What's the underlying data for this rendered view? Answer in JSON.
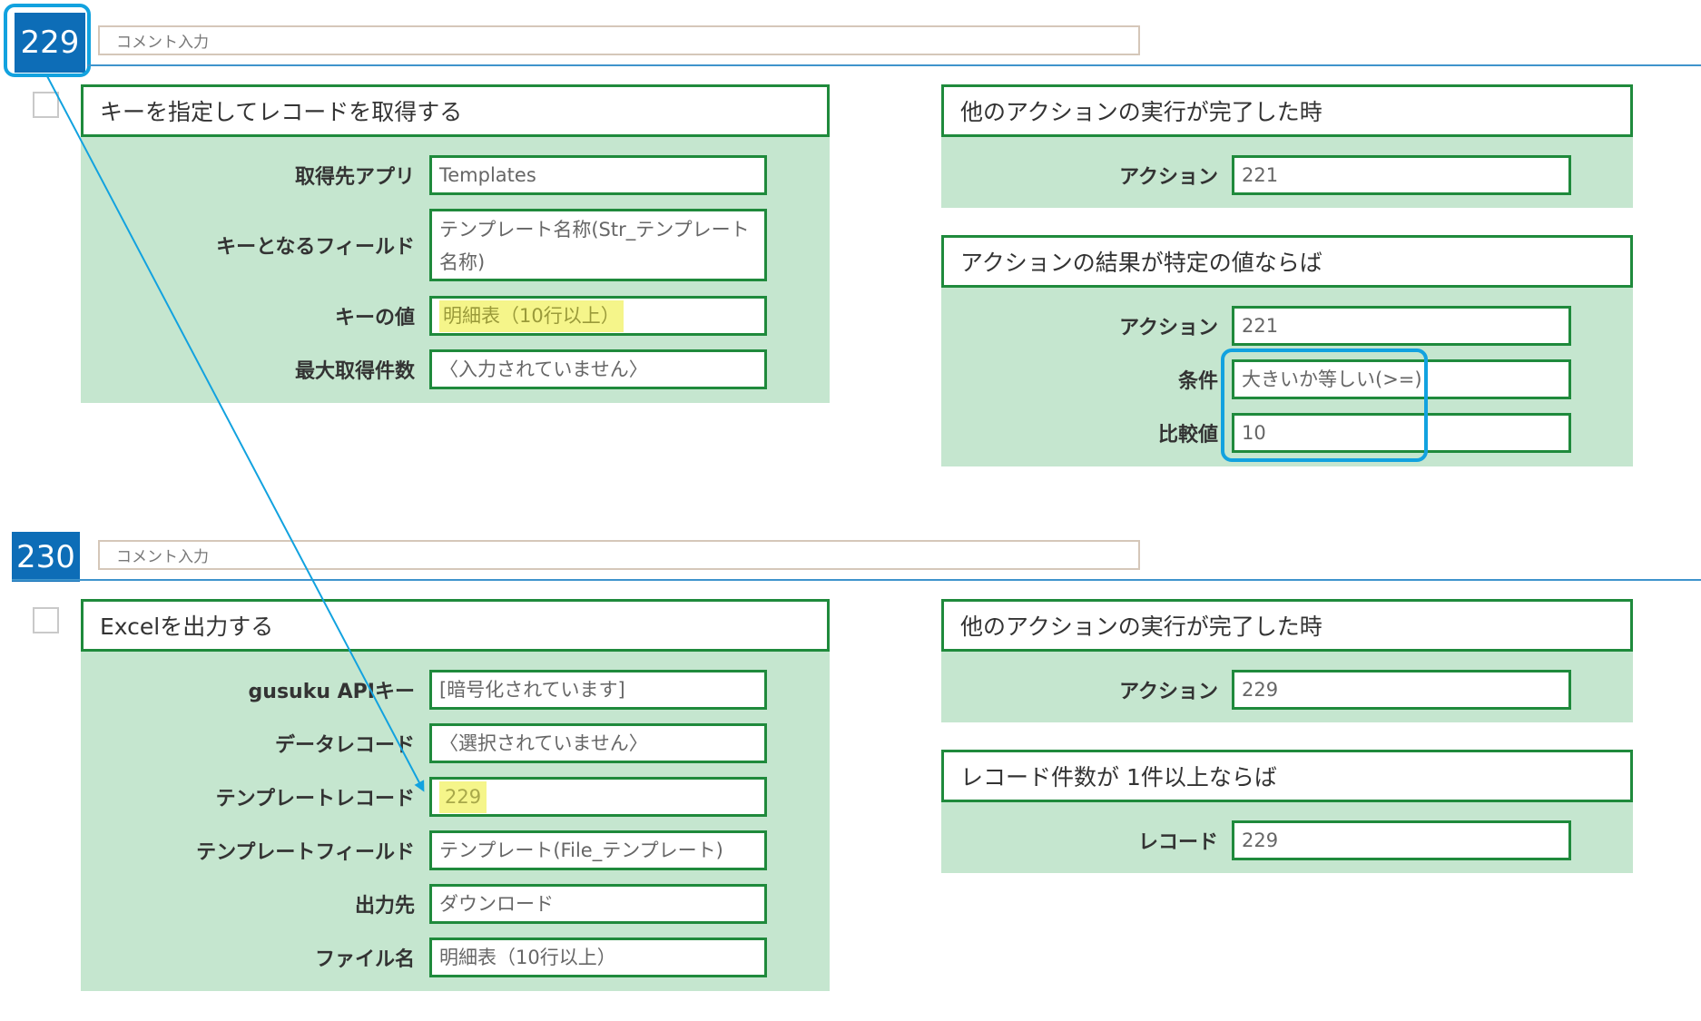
{
  "record1": {
    "number": "229",
    "comment_placeholder": "コメント入力",
    "action_panel": {
      "title": "キーを指定してレコードを取得する",
      "rows": [
        {
          "label": "取得先アプリ",
          "value": "Templates"
        },
        {
          "label": "キーとなるフィールド",
          "value": "テンプレート名称(Str_テンプレート名称)"
        },
        {
          "label": "キーの値",
          "value": "明細表（10行以上）"
        },
        {
          "label": "最大取得件数",
          "value": "〈入力されていません〉"
        }
      ]
    },
    "trigger_panel": {
      "title": "他のアクションの実行が完了した時",
      "rows": [
        {
          "label": "アクション",
          "value": "221"
        }
      ]
    },
    "condition_panel": {
      "title": "アクションの結果が特定の値ならば",
      "rows": [
        {
          "label": "アクション",
          "value": "221"
        },
        {
          "label": "条件",
          "value": "大きいか等しい(>=)"
        },
        {
          "label": "比較値",
          "value": "10"
        }
      ]
    }
  },
  "record2": {
    "number": "230",
    "comment_placeholder": "コメント入力",
    "action_panel": {
      "title": "Excelを出力する",
      "rows": [
        {
          "label": "gusuku APIキー",
          "value": "[暗号化されています]"
        },
        {
          "label": "データレコード",
          "value": "〈選択されていません〉"
        },
        {
          "label": "テンプレートレコード",
          "value": "229"
        },
        {
          "label": "テンプレートフィールド",
          "value": "テンプレート(File_テンプレート)"
        },
        {
          "label": "出力先",
          "value": "ダウンロード"
        },
        {
          "label": "ファイル名",
          "value": "明細表（10行以上）"
        }
      ]
    },
    "trigger_panel": {
      "title": "他のアクションの実行が完了した時",
      "rows": [
        {
          "label": "アクション",
          "value": "229"
        }
      ]
    },
    "condition_panel": {
      "title": "レコード件数が 1件以上ならば",
      "rows": [
        {
          "label": "レコード",
          "value": "229"
        }
      ]
    }
  },
  "colors": {
    "badge": "#0d6db7",
    "panel_bg": "#c5e6cf",
    "panel_border": "#1f8a3c",
    "callout": "#12a2df",
    "highlight": "#f5f58a"
  }
}
